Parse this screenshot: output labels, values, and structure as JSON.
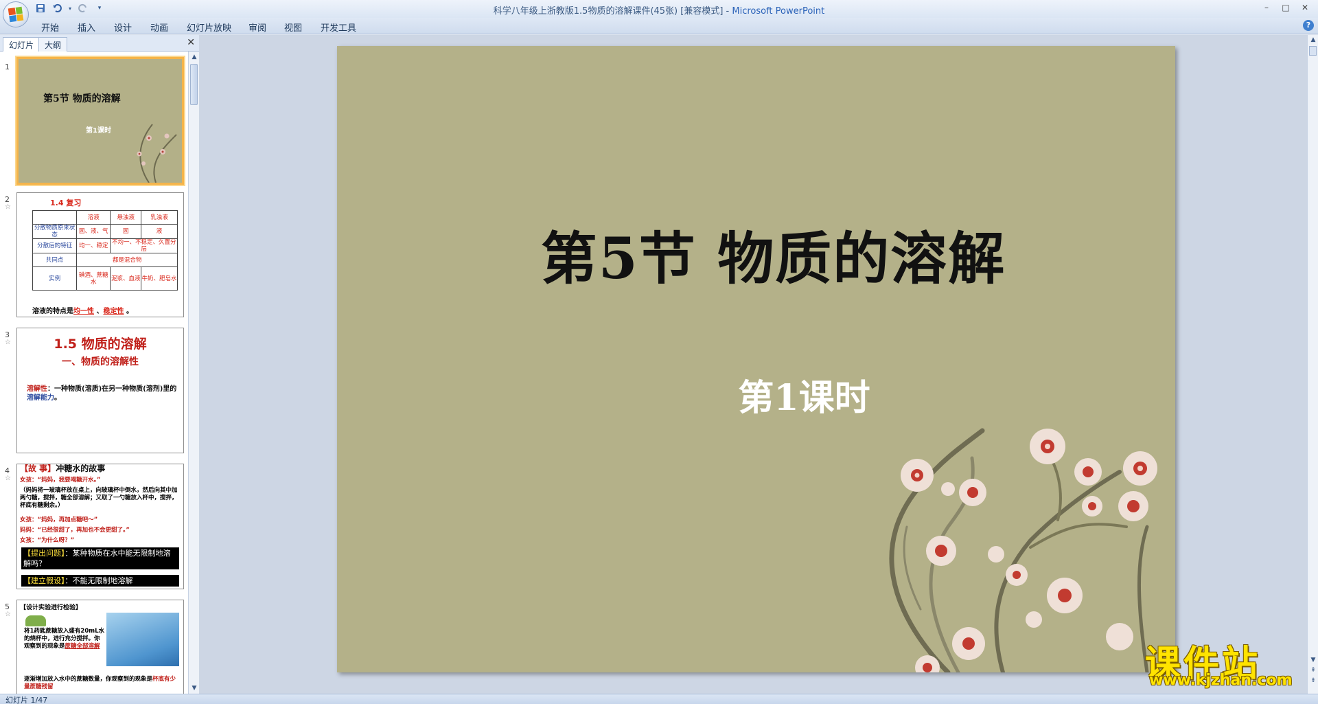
{
  "window": {
    "title": "科学八年级上浙教版1.5物质的溶解课件(45张) [兼容模式] - ",
    "app_name": "Microsoft PowerPoint",
    "controls": [
      "–",
      "□",
      "✕"
    ]
  },
  "quick_access": {
    "save_icon": "save-icon",
    "undo_icon": "undo-icon",
    "redo_icon": "redo-icon",
    "customize_icon": "customize-qat-icon"
  },
  "ribbon": {
    "tabs": [
      "开始",
      "插入",
      "设计",
      "动画",
      "幻灯片放映",
      "审阅",
      "视图",
      "开发工具"
    ],
    "help": "?"
  },
  "pane": {
    "tabs": [
      "幻灯片",
      "大纲"
    ],
    "close": "✕"
  },
  "thumbnails": {
    "s1": {
      "num": "1",
      "title": "第5节  物质的溶解",
      "sub": "第1课时"
    },
    "s2": {
      "num": "2",
      "heading": "1.4   复习",
      "table": {
        "header": [
          "",
          "溶液",
          "悬浊液",
          "乳浊液"
        ],
        "rows": [
          [
            "分散物质原来状态",
            "固、液、气",
            "固",
            "液"
          ],
          [
            "分散后的特征",
            "均一、稳定",
            "不均一、不稳定、久置分层",
            ""
          ],
          [
            "共同点",
            "都是混合物",
            "",
            ""
          ],
          [
            "实例",
            "碘酒、蔗糖水",
            "泥浆、血液",
            "牛奶、肥皂水"
          ]
        ]
      },
      "foot_prefix": "溶液的特点是",
      "foot_a": "均一性",
      "foot_sep": " 、",
      "foot_b": "稳定性",
      "foot_end": " 。"
    },
    "s3": {
      "num": "3",
      "h1": "1.5 物质的溶解",
      "h2": "一、物质的溶解性",
      "term": "溶解性",
      "body": "：一种物质(溶质)在另一种物质(溶剂)里的",
      "ability": "溶解能力",
      "end": "。"
    },
    "s4": {
      "num": "4",
      "head_tag": "【故 事】",
      "head_text": "冲糖水的故事",
      "lines": [
        "女孩：“妈妈，我要喝糖开水。”",
        "（妈妈将一玻璃杯放在桌上，向玻璃杯中倒水，然后向其中加两勺糖，搅拌，糖全部溶解；又取了一勺糖放入杯中，搅拌，杯底有糖剩余。）",
        "女孩：“妈妈，再加点糖吧～”",
        "妈妈：“已经很甜了，再加也不会更甜了。”",
        "女孩：“为什么呀？”"
      ],
      "q_tag": "【提出问题】",
      "q_text": "：某种物质在水中能无限制地溶解吗？",
      "h_tag": "【建立假设】",
      "h_text": "：不能无限制地溶解"
    },
    "s5": {
      "num": "5",
      "heading": "【设计实验进行检验】",
      "body": "将1药匙蔗糖放入盛有20mL水的烧杯中，进行充分搅拌。你观察到的现象是",
      "result": "蔗糖全部溶解",
      "bottom": "逐渐增加放入水中的蔗糖数量，你观察到的现象是",
      "bottom_red": "杯底有少量蔗糖残留"
    }
  },
  "slide": {
    "title": "第5节  物质的溶解",
    "subtitle": "第1课时"
  },
  "watermark": {
    "brand": "课件站",
    "url": "www.kjzhan.com"
  },
  "status": {
    "text": "幻灯片 1/47"
  },
  "colors": {
    "slide_bg": "#b4b189",
    "accent_red": "#c0201a",
    "selection": "#f5b44a"
  }
}
